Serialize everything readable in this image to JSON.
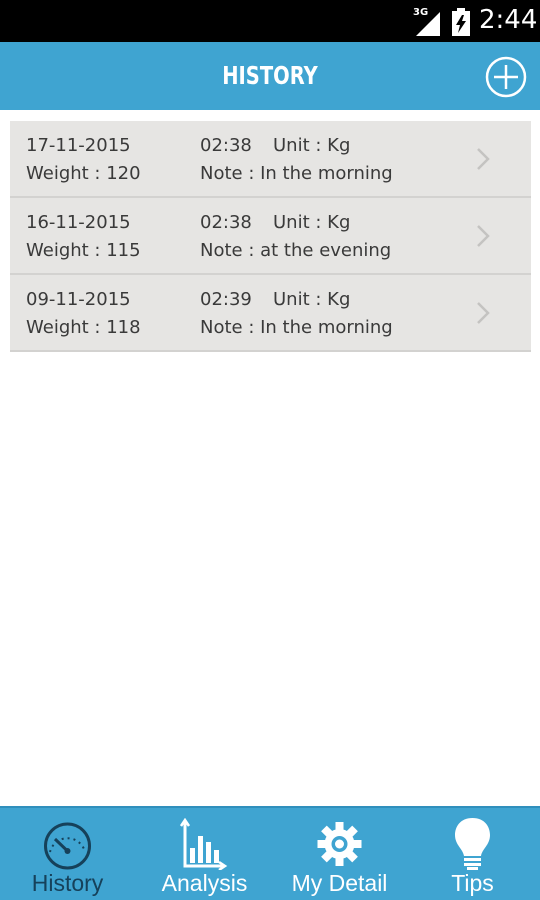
{
  "status_bar": {
    "network": "3G",
    "time": "2:44"
  },
  "header": {
    "title": "HISTORY",
    "add_icon": "plus-circle-icon"
  },
  "history": [
    {
      "date": "17-11-2015",
      "time": "02:38",
      "unit": "Unit : Kg",
      "weight": "Weight : 120",
      "note": "Note : In the morning"
    },
    {
      "date": "16-11-2015",
      "time": "02:38",
      "unit": "Unit : Kg",
      "weight": "Weight : 115",
      "note": "Note : at the evening"
    },
    {
      "date": "09-11-2015",
      "time": "02:39",
      "unit": "Unit : Kg",
      "weight": "Weight : 118",
      "note": "Note : In the morning"
    }
  ],
  "tabs": [
    {
      "label": "History",
      "icon": "gauge-icon",
      "active": true
    },
    {
      "label": "Analysis",
      "icon": "bar-chart-icon",
      "active": false
    },
    {
      "label": "My Detail",
      "icon": "gear-icon",
      "active": false
    },
    {
      "label": "Tips",
      "icon": "lightbulb-icon",
      "active": false
    }
  ],
  "colors": {
    "accent": "#3fa4d1",
    "active_tab": "#16415a",
    "list_background": "#e6e5e3",
    "text": "#3a3a3a"
  }
}
